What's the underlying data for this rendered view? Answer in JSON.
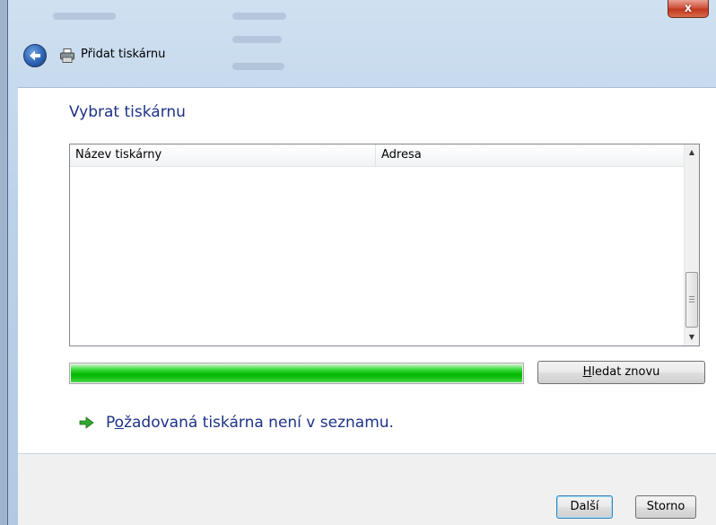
{
  "window": {
    "title": "Přidat tiskárnu",
    "close_label": "x"
  },
  "icons": {
    "back": "back-arrow-icon",
    "printer": "printer-icon",
    "link_arrow": "green-arrow-icon"
  },
  "page": {
    "heading": "Vybrat tiskárnu",
    "list": {
      "columns": [
        "Název tiskárny",
        "Adresa"
      ],
      "rows": []
    },
    "progress": {
      "value_percent": 100,
      "color": "#16c016"
    },
    "search_again": {
      "prefix": "",
      "mnemonic": "H",
      "rest": "ledat znovu"
    },
    "not_listed_link": {
      "prefix": "P",
      "mnemonic": "o",
      "rest": "žadovaná tiskárna není v seznamu."
    }
  },
  "footer": {
    "next_label": "Další",
    "cancel_label": "Storno"
  },
  "colors": {
    "heading": "#1e3287",
    "link": "#1e3287",
    "close": "#c2381d"
  }
}
